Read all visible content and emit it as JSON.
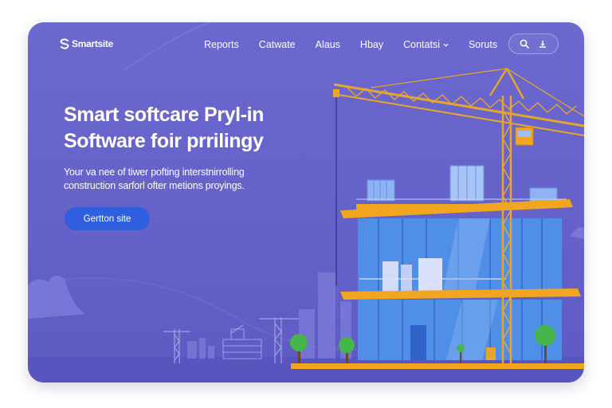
{
  "brand": {
    "name": "Smartsite"
  },
  "nav": {
    "items": [
      {
        "label": "Reports"
      },
      {
        "label": "Catwate"
      },
      {
        "label": "Alaus"
      },
      {
        "label": "Hbay"
      },
      {
        "label": "Contatsi",
        "has_dropdown": true
      },
      {
        "label": "Soruts"
      }
    ]
  },
  "header_icons": [
    "search-icon",
    "user-icon"
  ],
  "hero": {
    "title_lines": [
      "Smart softcare Pryl-in",
      "Software foir prrilingy"
    ],
    "subtitle_lines": [
      "Your va nee of tiwer pofting interstnirrolling",
      "construction sarforl ofter metions proyings."
    ],
    "cta_label": "Gertton site"
  },
  "colors": {
    "background": "#6b69cf",
    "cta": "#2f5fde",
    "crane": "#e8a52e",
    "floor_slab": "#f2a51e",
    "glass": "#4f8fe8",
    "text": "#ffffff"
  }
}
